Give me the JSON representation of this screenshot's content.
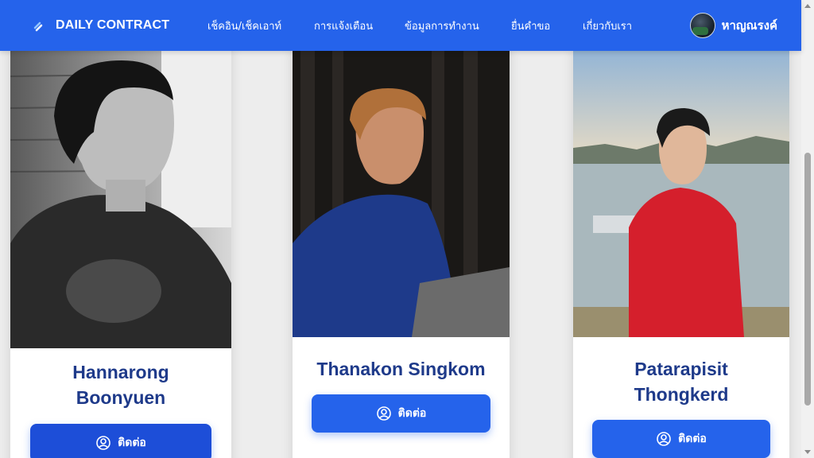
{
  "navbar": {
    "brand": "DAILY CONTRACT",
    "links": [
      "เช็คอิน/เช็คเอาท์",
      "การแจ้งเตือน",
      "ข้อมูลการทำงาน",
      "ยื่นคำขอ",
      "เกี่ยวกับเรา"
    ],
    "user_name": "หาญณรงค์"
  },
  "cards": [
    {
      "name_line1": "Hannarong",
      "name_line2": "Boonyuen",
      "button": "ติดต่อ"
    },
    {
      "name_line1": "Thanakon Singkom",
      "name_line2": "",
      "button": "ติดต่อ"
    },
    {
      "name_line1": "Patarapisit",
      "name_line2": "Thongkerd",
      "button": "ติดต่อ"
    }
  ],
  "colors": {
    "primary": "#2563eb",
    "name_text": "#1e3a8a",
    "page_bg": "#ededed"
  }
}
